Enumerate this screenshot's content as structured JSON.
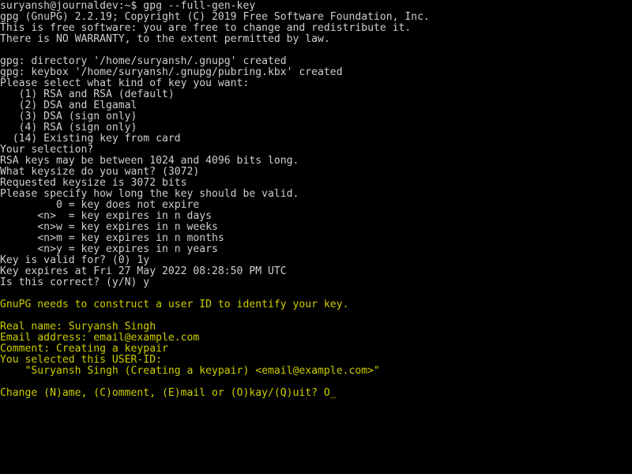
{
  "terminal": {
    "window_title": "suryansh@journaldev: ~",
    "background_color": "#000000",
    "foreground_color": "#cfcfcf",
    "accent_color": "#cdcd00",
    "columns": 99,
    "rows": 43,
    "cursor_glyph": "_"
  },
  "prompt": {
    "user": "suryansh",
    "host": "journaldev",
    "path": "~",
    "symbol": "$",
    "full": "suryansh@journaldev:~$",
    "command": "gpg --full-gen-key"
  },
  "lines": [
    {
      "text": "suryansh@journaldev:~$ gpg --full-gen-key",
      "color": "white"
    },
    {
      "text": "gpg (GnuPG) 2.2.19; Copyright (C) 2019 Free Software Foundation, Inc.",
      "color": "white"
    },
    {
      "text": "This is free software: you are free to change and redistribute it.",
      "color": "white"
    },
    {
      "text": "There is NO WARRANTY, to the extent permitted by law.",
      "color": "white"
    },
    {
      "text": "",
      "color": "white"
    },
    {
      "text": "gpg: directory '/home/suryansh/.gnupg' created",
      "color": "white"
    },
    {
      "text": "gpg: keybox '/home/suryansh/.gnupg/pubring.kbx' created",
      "color": "white"
    },
    {
      "text": "Please select what kind of key you want:",
      "color": "white"
    },
    {
      "text": "   (1) RSA and RSA (default)",
      "color": "white"
    },
    {
      "text": "   (2) DSA and Elgamal",
      "color": "white"
    },
    {
      "text": "   (3) DSA (sign only)",
      "color": "white"
    },
    {
      "text": "   (4) RSA (sign only)",
      "color": "white"
    },
    {
      "text": "  (14) Existing key from card",
      "color": "white"
    },
    {
      "text": "Your selection? ",
      "color": "white"
    },
    {
      "text": "RSA keys may be between 1024 and 4096 bits long.",
      "color": "white"
    },
    {
      "text": "What keysize do you want? (3072) ",
      "color": "white"
    },
    {
      "text": "Requested keysize is 3072 bits",
      "color": "white"
    },
    {
      "text": "Please specify how long the key should be valid.",
      "color": "white"
    },
    {
      "text": "         0 = key does not expire",
      "color": "white"
    },
    {
      "text": "      <n>  = key expires in n days",
      "color": "white"
    },
    {
      "text": "      <n>w = key expires in n weeks",
      "color": "white"
    },
    {
      "text": "      <n>m = key expires in n months",
      "color": "white"
    },
    {
      "text": "      <n>y = key expires in n years",
      "color": "white"
    },
    {
      "text": "Key is valid for? (0) 1y",
      "color": "white"
    },
    {
      "text": "Key expires at Fri 27 May 2022 08:28:50 PM UTC",
      "color": "white"
    },
    {
      "text": "Is this correct? (y/N) y",
      "color": "white"
    },
    {
      "text": "",
      "color": "white"
    },
    {
      "text": "GnuPG needs to construct a user ID to identify your key.",
      "color": "yellow"
    },
    {
      "text": "",
      "color": "yellow"
    },
    {
      "text": "Real name: Suryansh Singh",
      "color": "yellow"
    },
    {
      "text": "Email address: email@example.com",
      "color": "yellow"
    },
    {
      "text": "Comment: Creating a keypair",
      "color": "yellow"
    },
    {
      "text": "You selected this USER-ID:",
      "color": "yellow"
    },
    {
      "text": "    \"Suryansh Singh (Creating a keypair) <email@example.com>\"",
      "color": "yellow"
    },
    {
      "text": "",
      "color": "yellow"
    },
    {
      "text": "Change (N)ame, (C)omment, (E)mail or (O)kay/(Q)uit? O",
      "color": "yellow",
      "cursor": true
    }
  ],
  "session": {
    "program": "gpg",
    "program_version": "2.2.19",
    "copyright": "Copyright (C) 2019 Free Software Foundation, Inc.",
    "key_type_options": [
      "(1) RSA and RSA (default)",
      "(2) DSA and Elgamal",
      "(3) DSA (sign only)",
      "(4) RSA (sign only)",
      "(14) Existing key from card"
    ],
    "expiry_options": [
      "0 = key does not expire",
      "<n>  = key expires in n days",
      "<n>w = key expires in n weeks",
      "<n>m = key expires in n months",
      "<n>y = key expires in n years"
    ],
    "keysize_default": "3072",
    "keysize_range": "1024 and 4096",
    "validity_answer": "1y",
    "expiry_date": "Fri 27 May 2022 08:28:50 PM UTC",
    "confirm_answer": "y",
    "real_name": "Suryansh Singh",
    "email": "email@example.com",
    "comment": "Creating a keypair",
    "user_id": "\"Suryansh Singh (Creating a keypair) <email@example.com>\"",
    "final_prompt": "Change (N)ame, (C)omment, (E)mail or (O)kay/(Q)uit?",
    "final_answer": "O"
  }
}
